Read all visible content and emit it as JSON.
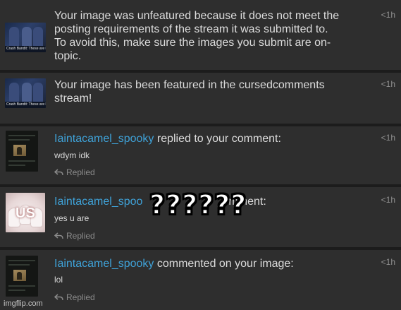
{
  "notifications": [
    {
      "message": "Your image was unfeatured because it does not meet the posting requirements of the stream it was submitted to. To avoid this, make sure the images you submit are on-topic.",
      "lines": [
        "Your image was unfeatured because it does not meet the",
        "posting requirements of the stream it was submitted to.",
        "To avoid this, make sure the images you submit are on-",
        "topic."
      ],
      "time": "<1h",
      "thumbnail_caption": "Crash Bandit: These are l",
      "thumbnail_icon": "news-screenshot-thumbnail"
    },
    {
      "message": "Your image has been featured in the cursedcomments stream!",
      "lines": [
        "Your image has been featured in the cursedcomments",
        "stream!"
      ],
      "time": "<1h",
      "thumbnail_caption": "Crash Bandit: These are l",
      "thumbnail_icon": "news-screenshot-thumbnail"
    },
    {
      "user": "Iaintacamel_spooky",
      "action": " replied to your comment:",
      "comment": "wdym idk",
      "status": "Replied",
      "time": "<1h",
      "thumbnail_icon": "comment-screenshot-thumbnail"
    },
    {
      "user": "Iaintacamel_spoo",
      "action": "mment:",
      "comment": "yes u are",
      "status": "Replied",
      "time": "<1h",
      "thumbnail_text": "US",
      "thumbnail_icon": "us-meme-thumbnail"
    },
    {
      "user": "Iaintacamel_spooky",
      "action": " commented on your image:",
      "comment": "lol",
      "status": "Replied",
      "time": "<1h",
      "thumbnail_icon": "comment-screenshot-thumbnail"
    }
  ],
  "overlay_text": "??????",
  "watermark": "imgflip.com",
  "colors": {
    "background": "#2e2e2e",
    "separator": "#1c1c1c",
    "username": "#3fa2d8",
    "text": "#dcdcdc",
    "muted": "#8a8a8a"
  },
  "icons": {
    "replied": "reply-arrow-icon"
  }
}
